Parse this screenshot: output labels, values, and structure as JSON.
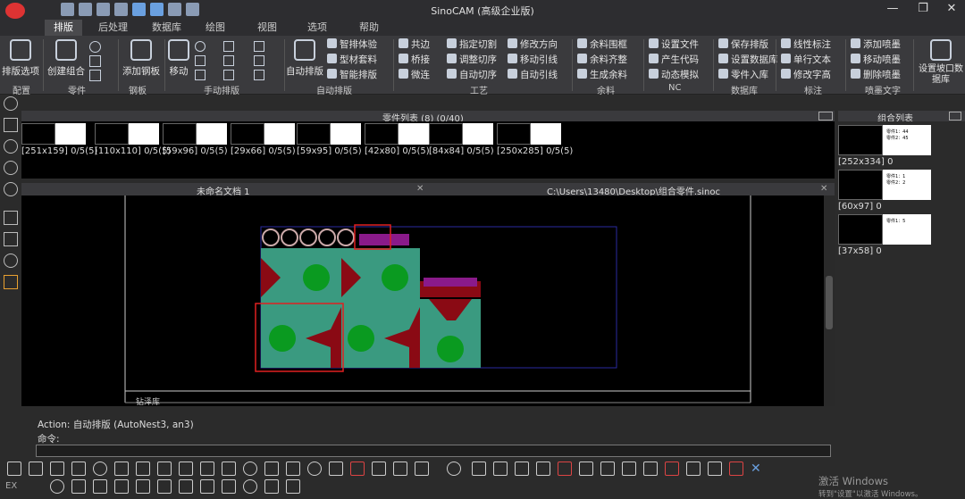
{
  "app": {
    "title": "SinoCAM (高级企业版)"
  },
  "tabs": [
    "排版",
    "后处理",
    "数据库",
    "绘图",
    "视图",
    "选项",
    "帮助"
  ],
  "ribbon": {
    "big_buttons": [
      "排版选项",
      "创建组合",
      "添加钢板",
      "移动",
      "自动排版",
      "设置坡口数据库"
    ],
    "group_labels": [
      "配置",
      "零件",
      "钢板",
      "手动排版",
      "自动排版",
      "工艺",
      "余料",
      "NC",
      "数据库",
      "标注",
      "喷墨文字"
    ],
    "small_buttons": {
      "auto_nest": [
        "智排体验",
        "型材套料",
        "智能排版"
      ],
      "process1": [
        "共边",
        "桥接",
        "微连"
      ],
      "process2": [
        "指定切割",
        "调整切序",
        "自动切序"
      ],
      "process3": [
        "修改方向",
        "移动引线",
        "自动引线"
      ],
      "remnant": [
        "余料围框",
        "余料齐整",
        "生成余料"
      ],
      "nc": [
        "设置文件",
        "产生代码",
        "动态模拟"
      ],
      "database": [
        "保存排版",
        "设置数据库",
        "零件入库"
      ],
      "annotate": [
        "线性标注",
        "单行文本",
        "修改字高"
      ],
      "ink": [
        "添加喷墨",
        "移动喷墨",
        "删除喷墨"
      ]
    }
  },
  "part_list": {
    "header": "零件列表 (8) (0/40)",
    "items": [
      "[251x159] 0/5(5)",
      "[110x110] 0/5(5)",
      "[59x96] 0/5(5)",
      "[29x66] 0/5(5)",
      "[59x95] 0/5(5)",
      "[42x80] 0/5(5)",
      "[84x84] 0/5(5)",
      "[250x285] 0/5(5)"
    ]
  },
  "documents": {
    "doc1": "未命名文档 1",
    "doc2": "C:\\Users\\13480\\Desktop\\组合零件.sinoc",
    "canvas_label": "钻泽库"
  },
  "combo_list": {
    "header": "组合列表",
    "items": [
      "[252x334] 0",
      "[60x97] 0",
      "[37x58] 0"
    ],
    "thumb_text": [
      [
        "零件1：44",
        "零件2：45"
      ],
      [
        "零件1：1",
        "零件2：2"
      ],
      [
        "零件1：5"
      ]
    ]
  },
  "command": {
    "action": "Action: 自动排版 (AutoNest3, an3)",
    "prompt": "命令:",
    "side_text": "EX"
  },
  "watermark": {
    "line1": "激活 Windows",
    "line2": "转到\"设置\"以激活 Windows。"
  }
}
